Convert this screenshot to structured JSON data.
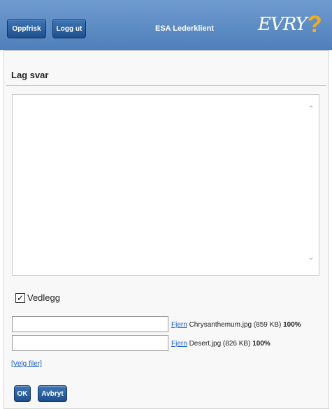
{
  "header": {
    "refresh_label": "Oppfrisk",
    "logout_label": "Logg ut",
    "app_title": "ESA Lederklient",
    "logo_text": "EVRY",
    "help_symbol": "?",
    "background_color": "#5a88c3",
    "button_color": "#2a5a9a"
  },
  "page": {
    "title": "Lag svar"
  },
  "reply": {
    "value": ""
  },
  "attachments": {
    "checkbox_label": "Vedlegg",
    "checked": true,
    "files": [
      {
        "input_value": "",
        "remove_label": "Fjern",
        "name_size": "Chrysanthemum.jpg (859 KB)",
        "progress": "100%"
      },
      {
        "input_value": "",
        "remove_label": "Fjern",
        "name_size": "Desert.jpg (826 KB)",
        "progress": "100%"
      }
    ],
    "select_files_label": "[Velg filer]"
  },
  "footer": {
    "ok_label": "OK",
    "cancel_label": "Avbryt"
  },
  "icons": {
    "check": "check-icon",
    "scroll_up": "chevron-up-icon",
    "scroll_down": "chevron-down-icon"
  }
}
